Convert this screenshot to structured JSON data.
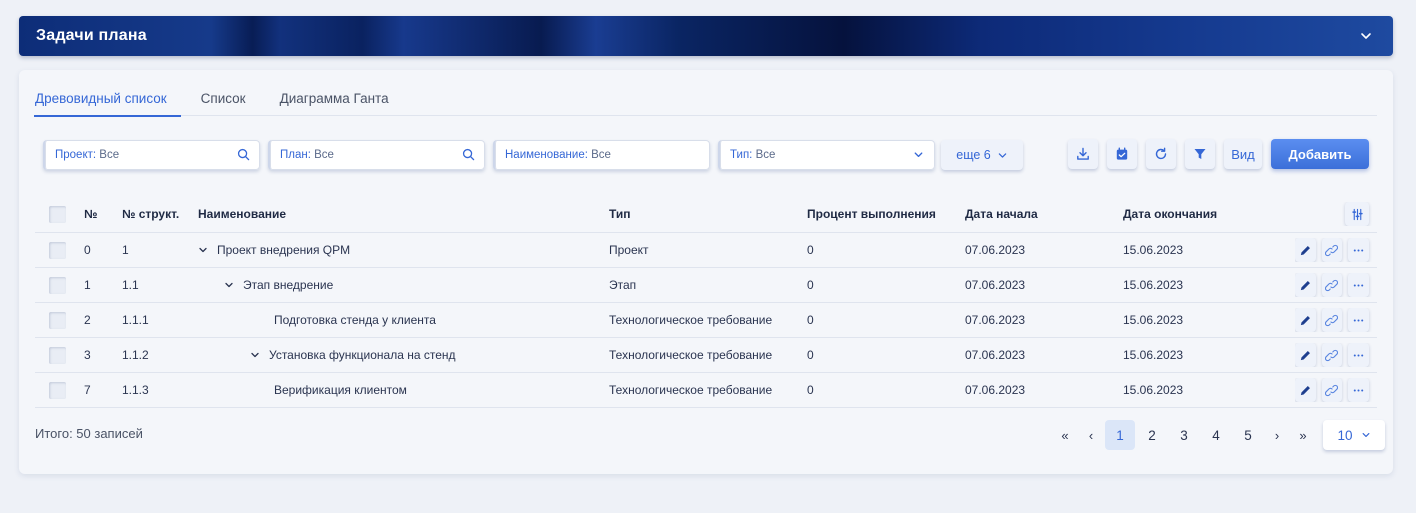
{
  "header": {
    "title": "Задачи плана"
  },
  "tabs": [
    {
      "label": "Древовидный список",
      "active": true
    },
    {
      "label": "Список",
      "active": false
    },
    {
      "label": "Диаграмма Ганта",
      "active": false
    }
  ],
  "filters": {
    "project": {
      "label": "Проект:",
      "value": "Все"
    },
    "plan": {
      "label": "План:",
      "value": "Все"
    },
    "name": {
      "label": "Наименование:",
      "value": "Все"
    },
    "type": {
      "label": "Тип:",
      "value": "Все"
    },
    "more_label": "еще 6"
  },
  "toolbar": {
    "view_label": "Вид",
    "add_label": "Добавить"
  },
  "table": {
    "columns": {
      "num": "№",
      "struct": "№ структ.",
      "name": "Наименование",
      "type": "Тип",
      "percent": "Процент выполнения",
      "start": "Дата начала",
      "end": "Дата окончания"
    },
    "rows": [
      {
        "num": "0",
        "struct": "1",
        "name": "Проект внедрения QPM",
        "type": "Проект",
        "percent": "0",
        "start": "07.06.2023",
        "end": "15.06.2023"
      },
      {
        "num": "1",
        "struct": "1.1",
        "name": "Этап внедрение",
        "type": "Этап",
        "percent": "0",
        "start": "07.06.2023",
        "end": "15.06.2023"
      },
      {
        "num": "2",
        "struct": "1.1.1",
        "name": "Подготовка стенда у клиента",
        "type": "Технологическое требование",
        "percent": "0",
        "start": "07.06.2023",
        "end": "15.06.2023"
      },
      {
        "num": "3",
        "struct": "1.1.2",
        "name": "Установка функционала на стенд",
        "type": "Технологическое требование",
        "percent": "0",
        "start": "07.06.2023",
        "end": "15.06.2023"
      },
      {
        "num": "7",
        "struct": "1.1.3",
        "name": "Верификация клиентом",
        "type": "Технологическое требование",
        "percent": "0",
        "start": "07.06.2023",
        "end": "15.06.2023"
      }
    ]
  },
  "footer": {
    "total": "Итого: 50 записей",
    "pages": [
      "1",
      "2",
      "3",
      "4",
      "5"
    ],
    "page_size": "10",
    "first": "«",
    "prev": "‹",
    "next": "›",
    "last": "»"
  },
  "colors": {
    "accent": "#3567d6",
    "header_dark": "#0a2260"
  }
}
